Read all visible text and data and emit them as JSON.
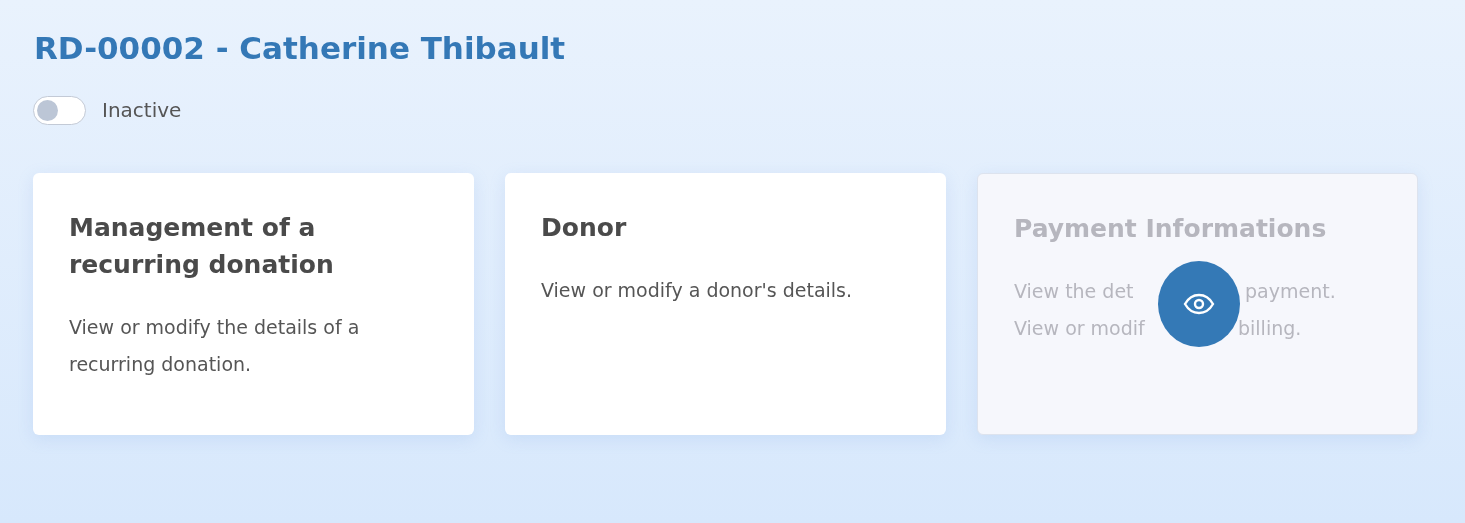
{
  "header": {
    "title": "RD-00002 - Catherine Thibault",
    "toggle": {
      "label": "Inactive",
      "on": false
    }
  },
  "cards": [
    {
      "kind": "text",
      "title": "Management of a recurring donation",
      "faded": false,
      "description": "View or modify the details of a recurring donation."
    },
    {
      "kind": "text",
      "title": "Donor",
      "faded": false,
      "description": "View or modify a donor's details."
    },
    {
      "kind": "covered",
      "title": "Payment Informations",
      "faded": true,
      "lines": [
        [
          "View the det",
          "payment."
        ],
        [
          "View or modif",
          "billing."
        ]
      ],
      "overlay_button": true
    }
  ]
}
